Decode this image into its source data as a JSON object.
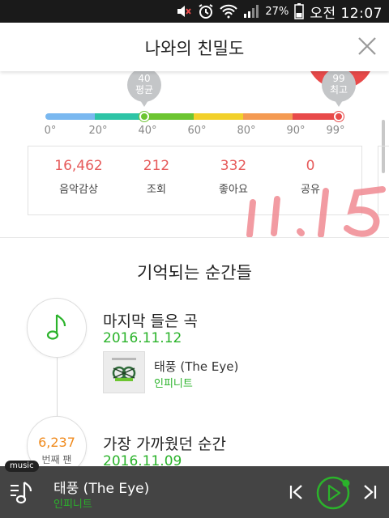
{
  "status_bar": {
    "battery_percent": "27%",
    "time": "오전 12:07",
    "icons": [
      "mute-icon",
      "alarm-icon",
      "wifi-icon",
      "signal-icon",
      "battery-icon"
    ]
  },
  "header": {
    "title": "나와의 친밀도",
    "close_icon": "close-icon"
  },
  "gauge": {
    "avg_bubble": {
      "value": "40",
      "label": "평균"
    },
    "max_bubble": {
      "value": "99",
      "label": "최고"
    },
    "ticks": [
      "0°",
      "20°",
      "40°",
      "60°",
      "80°",
      "90°",
      "99°"
    ],
    "avg_level": 40,
    "max_level": 99,
    "segment_colors": [
      "#7ab8f0",
      "#2dc4a6",
      "#6cc531",
      "#f2d02a",
      "#f49a52",
      "#e84a4a"
    ]
  },
  "stats": [
    {
      "value": "16,462",
      "label": "음악감상"
    },
    {
      "value": "212",
      "label": "조회"
    },
    {
      "value": "332",
      "label": "좋아요"
    },
    {
      "value": "0",
      "label": "공유"
    }
  ],
  "handwriting": "11.15",
  "section_title": "기억되는 순간들",
  "moments": [
    {
      "title": "마지막 들은 곡",
      "date": "2016.11.12",
      "song_title": "태풍 (The Eye)",
      "song_artist": "인피니트"
    },
    {
      "title": "가장 가까웠던 순간",
      "date": "2016.11.09",
      "fan_number": "6,237",
      "fan_label": "번째 팬"
    }
  ],
  "player": {
    "badge": "music",
    "title": "태풍 (The Eye)",
    "artist": "인피니트"
  },
  "colors": {
    "accent_green": "#2bb32b",
    "stat_red": "#e65a5a",
    "fan_orange": "#f08a1c",
    "player_bg": "#444444"
  }
}
